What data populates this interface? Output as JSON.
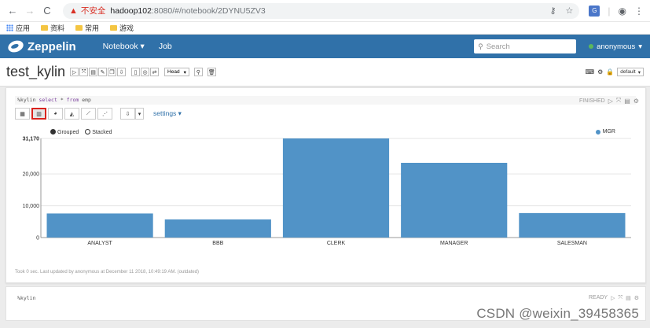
{
  "browser": {
    "insecure_label": "不安全",
    "url_host": "hadoop102",
    "url_rest": ":8080/#/notebook/2DYNU5ZV3",
    "bookmarks": [
      "应用",
      "资料",
      "常用",
      "游戏"
    ]
  },
  "navbar": {
    "brand": "Zeppelin",
    "notebook_menu": "Notebook",
    "job_menu": "Job",
    "search_placeholder": "Search",
    "username": "anonymous"
  },
  "notebook": {
    "title": "test_kylin",
    "head_select": "Head",
    "default_select": "default"
  },
  "paragraph1": {
    "code_prefix": "%kylin",
    "code_keyword1": "select",
    "code_mid": "*",
    "code_keyword2": "from",
    "code_table": "emp",
    "status": "FINISHED",
    "settings_label": "settings",
    "grouped_label": "Grouped",
    "stacked_label": "Stacked",
    "footer": "Took 0 sec. Last updated by anonymous at December 11 2018, 10:49:19 AM. (outdated)"
  },
  "paragraph2": {
    "code": "%kylin",
    "status": "READY"
  },
  "watermark": "CSDN @weixin_39458365",
  "colors": {
    "navbar": "#3071a9",
    "bar": "#5193c7",
    "highlight": "#d9231d"
  },
  "chart_data": {
    "type": "bar",
    "categories": [
      "ANALYST",
      "BBB",
      "CLERK",
      "MANAGER",
      "SALESMAN"
    ],
    "series": [
      {
        "name": "MGR",
        "values": [
          7566,
          5700,
          31170,
          23500,
          7698
        ]
      }
    ],
    "ylim": [
      0,
      31170
    ],
    "yticks": [
      0,
      10000,
      20000,
      31170
    ],
    "ytick_labels": [
      "0",
      "10,000",
      "20,000",
      "31,170"
    ],
    "legend": "top-right",
    "grid": true
  }
}
